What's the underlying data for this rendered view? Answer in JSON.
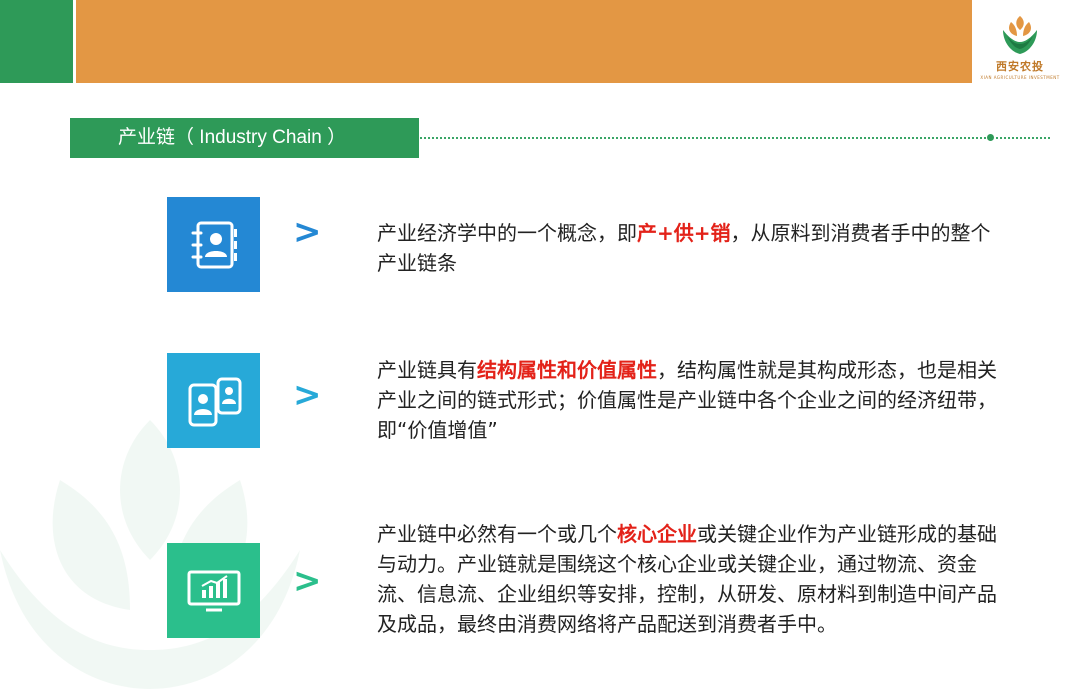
{
  "logo": {
    "name_cn": "西安农投",
    "name_en": "XIAN AGRICULTURE INVESTMENT"
  },
  "title": {
    "cn": "产业链",
    "en_open": "（ Industry Chain ）"
  },
  "items": [
    {
      "icon": "contact-book-icon",
      "segments": [
        {
          "text": "产业经济学中的一个概念，即",
          "hl": false
        },
        {
          "text": "产+供+销",
          "hl": true
        },
        {
          "text": "，从原料到消费者手中的整个产业链条",
          "hl": false
        }
      ]
    },
    {
      "icon": "mobile-users-icon",
      "segments": [
        {
          "text": "产业链具有",
          "hl": false
        },
        {
          "text": "结构属性和价值属性",
          "hl": true
        },
        {
          "text": "，结构属性就是其构成形态，也是相关产业之间的链式形式；价值属性是产业链中各个企业之间的经济纽带，即“价值增值”",
          "hl": false
        }
      ]
    },
    {
      "icon": "monitor-chart-icon",
      "segments": [
        {
          "text": "产业链中必然有一个或几个",
          "hl": false
        },
        {
          "text": "核心企业",
          "hl": true
        },
        {
          "text": "或关键企业作为产业链形成的基础与动力。产业链就是围绕这个核心企业或关键企业，通过物流、资金流、信息流、企业组织等安排，控制，从研发、原材料到制造中间产品及成品，最终由消费网络将产品配送到消费者手中。",
          "hl": false
        }
      ]
    }
  ],
  "arrow_glyph": ">",
  "colors": {
    "green": "#2e9a58",
    "orange": "#e39744",
    "blue": "#2488d4",
    "cyan": "#27a9d8",
    "teal": "#2bbf8c",
    "highlight": "#e32219"
  }
}
